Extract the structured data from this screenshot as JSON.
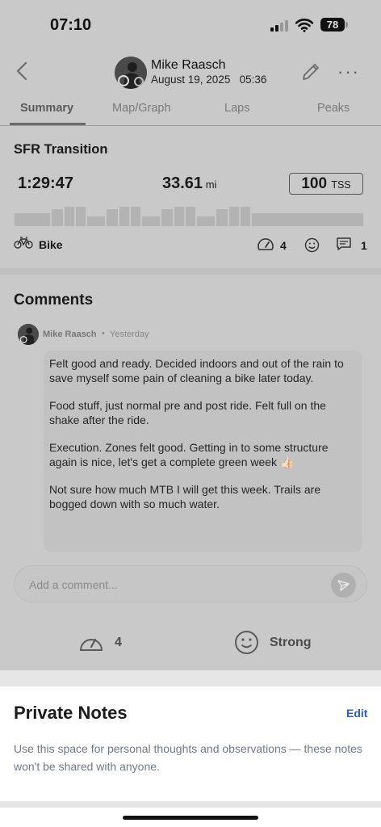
{
  "status_bar": {
    "time": "07:10",
    "battery": "78"
  },
  "header": {
    "name": "Mike Raasch",
    "date": "August 19, 2025",
    "time": "05:36"
  },
  "tabs": [
    {
      "label": "Summary",
      "active": true
    },
    {
      "label": "Map/Graph",
      "active": false
    },
    {
      "label": "Laps",
      "active": false
    },
    {
      "label": "Peaks",
      "active": false
    }
  ],
  "workout": {
    "title": "SFR Transition",
    "duration": "1:29:47",
    "distance": "33.61",
    "distance_unit": "mi",
    "tss_value": "100",
    "tss_unit": "TSS",
    "sport": "Bike",
    "sport_icon": "bike-icon",
    "rpe": "4",
    "comments_count": "1"
  },
  "comments": {
    "title": "Comments",
    "items": [
      {
        "author": "Mike Raasch",
        "separator": "•",
        "time": "Yesterday",
        "paragraphs": [
          "Felt good and ready. Decided indoors and out of the rain to save myself some pain of cleaning a bike later today.",
          "Food stuff, just normal pre and post ride. Felt full on the shake after the ride.",
          "Execution. Zones felt good. Getting in to some structure again is nice, let's get a complete green week",
          "Not sure how much MTB I will get this week. Trails are bogged down with so much water."
        ],
        "emoji": "👍🏻"
      }
    ],
    "add_placeholder": "Add a comment..."
  },
  "feedback": {
    "rpe": "4",
    "feeling": "Strong"
  },
  "private_notes": {
    "title": "Private Notes",
    "edit_label": "Edit",
    "description": "Use this space for personal thoughts and observations — these notes won't be shared with anyone."
  },
  "colors": {
    "accent": "#2a5bd7",
    "overlay": "#c9c9c9"
  }
}
